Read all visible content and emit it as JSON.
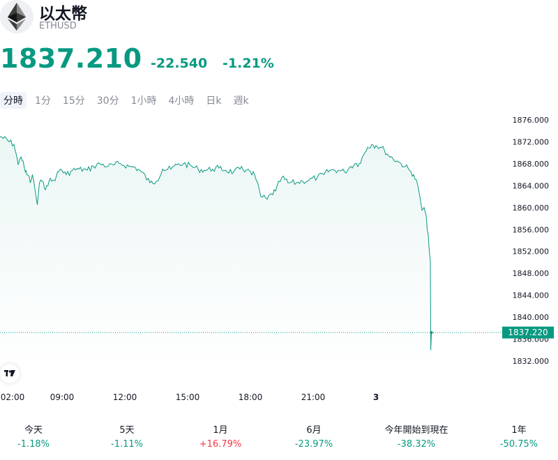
{
  "header": {
    "name": "以太幣",
    "symbol": "ETHUSD",
    "icon": "ethereum-icon"
  },
  "quote": {
    "price": "1837.210",
    "change": "-22.540",
    "change_pct": "-1.21%"
  },
  "tabs": [
    "分時",
    "1分",
    "15分",
    "30分",
    "1小時",
    "4小時",
    "日k",
    "週k"
  ],
  "active_tab": "分時",
  "colors": {
    "line": "#089981",
    "negative": "#089981",
    "positive": "#f23645"
  },
  "chart_data": {
    "type": "area",
    "price_label": "1837.220",
    "ylim": [
      1830.5,
      1877.5
    ],
    "y_ticks": [
      "1876.000",
      "1872.000",
      "1868.000",
      "1864.000",
      "1860.000",
      "1856.000",
      "1852.000",
      "1848.000",
      "1844.000",
      "1840.000",
      "1836.000",
      "1832.000"
    ],
    "y_tick_values": [
      1876,
      1872,
      1868,
      1864,
      1860,
      1856,
      1852,
      1848,
      1844,
      1840,
      1836,
      1832
    ],
    "x_ticks": [
      "02:00",
      "09:00",
      "12:00",
      "15:00",
      "18:00",
      "21:00",
      "3"
    ],
    "x_tick_hours": [
      2,
      9,
      12,
      15,
      18,
      21,
      24
    ],
    "xlim": [
      2,
      26.6
    ],
    "x": [
      2.0,
      2.2,
      2.5,
      2.8,
      3.2,
      3.5,
      3.8,
      4.0,
      4.3,
      4.5,
      4.8,
      5.2,
      5.5,
      5.8,
      6.2,
      6.5,
      6.8,
      7.2,
      7.5,
      7.8,
      8.2,
      8.5,
      8.8,
      9.2,
      9.5,
      9.8,
      10.2,
      10.5,
      10.8,
      11.2,
      11.5,
      11.8,
      12.2,
      12.5,
      12.8,
      13.2,
      13.5,
      13.8,
      14.2,
      14.5,
      14.8,
      15.2,
      15.5,
      15.8,
      16.2,
      16.5,
      16.8,
      17.2,
      17.5,
      17.8,
      17.9,
      18.0,
      18.2,
      18.5,
      18.8,
      19.0,
      19.2,
      19.5,
      19.8,
      20.2,
      20.5,
      20.8,
      21.2,
      21.5,
      21.8,
      22.2,
      22.5,
      22.8,
      23.0,
      23.2,
      23.4,
      23.6,
      23.8,
      24.0,
      24.2,
      24.4,
      24.6,
      24.8,
      25.0,
      25.2,
      25.4,
      25.6,
      25.8,
      26.0,
      26.1,
      26.2,
      26.3,
      26.4,
      26.45,
      26.5,
      26.55,
      26.58,
      26.6,
      26.62,
      26.65
    ],
    "y": [
      1873.0,
      1871.5,
      1869.8,
      1867.8,
      1869.2,
      1868.5,
      1866.5,
      1866.0,
      1865.8,
      1864.5,
      1866.0,
      1863.0,
      1860.5,
      1864.5,
      1864.8,
      1863.5,
      1864.0,
      1865.0,
      1864.8,
      1865.0,
      1865.8,
      1866.5,
      1867.0,
      1866.0,
      1866.8,
      1867.0,
      1866.8,
      1867.5,
      1868.0,
      1867.5,
      1867.8,
      1868.0,
      1867.5,
      1867.3,
      1866.5,
      1864.5,
      1864.8,
      1867.0,
      1867.0,
      1867.8,
      1868.0,
      1867.5,
      1867.0,
      1866.8,
      1867.0,
      1867.2,
      1866.8,
      1866.5,
      1867.0,
      1866.8,
      1867.0,
      1866.5,
      1866.0,
      1862.0,
      1861.5,
      1862.5,
      1863.0,
      1865.5,
      1864.5,
      1864.5,
      1864.8,
      1865.0,
      1865.5,
      1866.0,
      1866.8,
      1866.8,
      1866.5,
      1867.5,
      1868.0,
      1868.0,
      1869.5,
      1871.0,
      1871.5,
      1871.3,
      1871.0,
      1870.5,
      1869.5,
      1869.0,
      1868.5,
      1868.0,
      1867.5,
      1866.8,
      1866.0,
      1864.0,
      1862.0,
      1859.5,
      1860.0,
      1858.5,
      1856.0,
      1855.0,
      1852.0,
      1851.0,
      1850.0,
      1834.0,
      1837.2
    ]
  },
  "performance": [
    {
      "label": "今天",
      "value": "-1.18%",
      "dir": "neg"
    },
    {
      "label": "5天",
      "value": "-1.11%",
      "dir": "neg"
    },
    {
      "label": "1月",
      "value": "+16.79%",
      "dir": "pos"
    },
    {
      "label": "6月",
      "value": "-23.97%",
      "dir": "neg"
    },
    {
      "label": "今年開始到現在",
      "value": "-38.32%",
      "dir": "neg"
    },
    {
      "label": "1年",
      "value": "-50.75%",
      "dir": "neg"
    }
  ]
}
